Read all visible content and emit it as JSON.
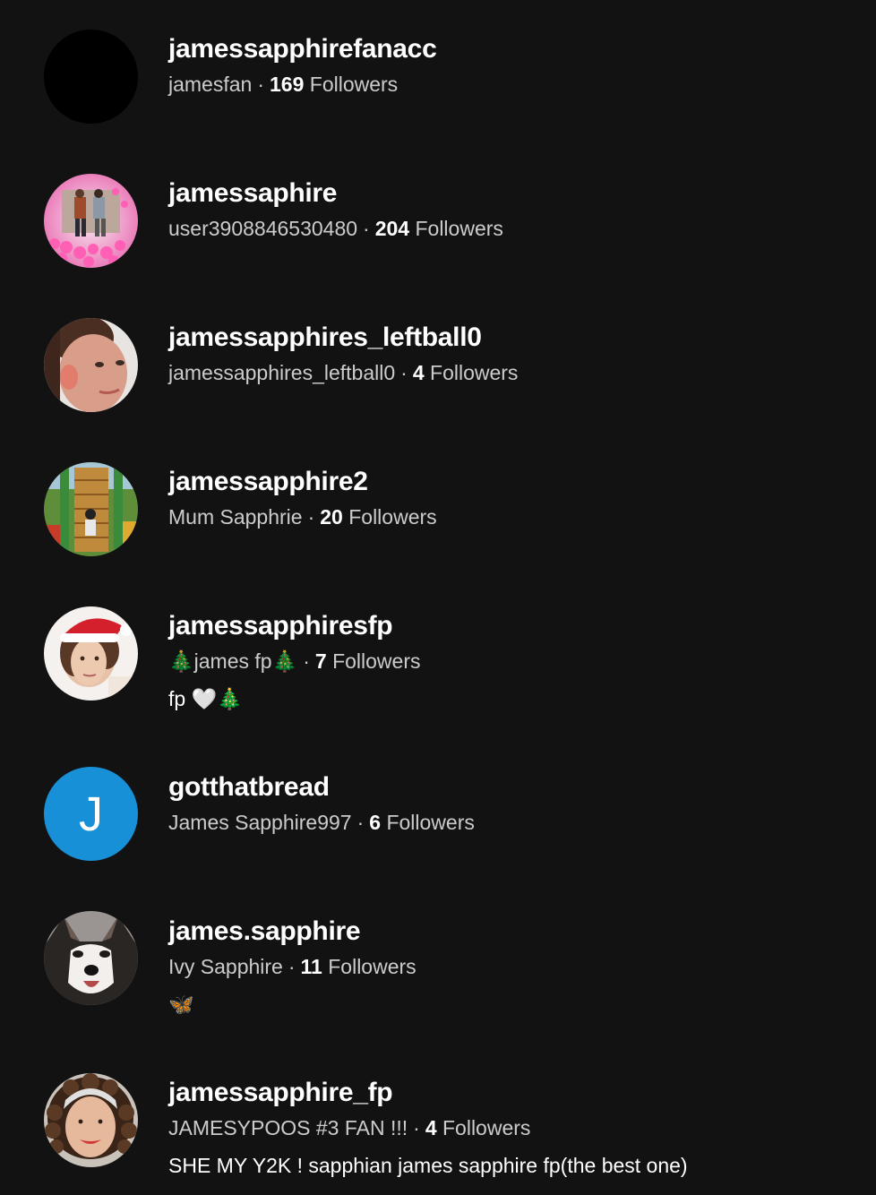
{
  "accent": "#1890d8",
  "users": [
    {
      "username": "jamessapphirefanacc",
      "nickname": "jamesfan",
      "separator": "·",
      "follower_count": "169",
      "followers_label": "Followers",
      "bio": "",
      "avatar": "black-avatar"
    },
    {
      "username": "jamessaphire",
      "nickname": "user3908846530480",
      "separator": "·",
      "follower_count": "204",
      "followers_label": "Followers",
      "bio": "",
      "avatar": "couple-photo-avatar"
    },
    {
      "username": "jamessapphires_leftball0",
      "nickname": "jamessapphires_leftball0",
      "separator": "·",
      "follower_count": "4",
      "followers_label": "Followers",
      "bio": "",
      "avatar": "face-photo-avatar"
    },
    {
      "username": "jamessapphire2",
      "nickname": "Mum Sapphrie",
      "separator": "·",
      "follower_count": "20",
      "followers_label": "Followers",
      "bio": "",
      "avatar": "playground-photo-avatar"
    },
    {
      "username": "jamessapphiresfp",
      "nickname": "🎄james fp🎄",
      "separator": "·",
      "follower_count": "7",
      "followers_label": "Followers",
      "bio": "fp 🤍🎄",
      "avatar": "santa-hat-photo-avatar"
    },
    {
      "username": "gotthatbread",
      "nickname": "James Sapphire997",
      "separator": "·",
      "follower_count": "6",
      "followers_label": "Followers",
      "bio": "",
      "avatar": "initial-avatar",
      "initial": "J",
      "avatar_color": "#1890d8"
    },
    {
      "username": "james.sapphire",
      "nickname": "Ivy Sapphire",
      "separator": "·",
      "follower_count": "11",
      "followers_label": "Followers",
      "bio": "🦋",
      "avatar": "husky-photo-avatar"
    },
    {
      "username": "jamessapphire_fp",
      "nickname": "JAMESYPOOS #3 FAN !!!",
      "separator": "·",
      "follower_count": "4",
      "followers_label": "Followers",
      "bio": "SHE MY Y2K ! sapphian james sapphire fp(the best one)",
      "avatar": "curly-hair-photo-avatar"
    }
  ]
}
